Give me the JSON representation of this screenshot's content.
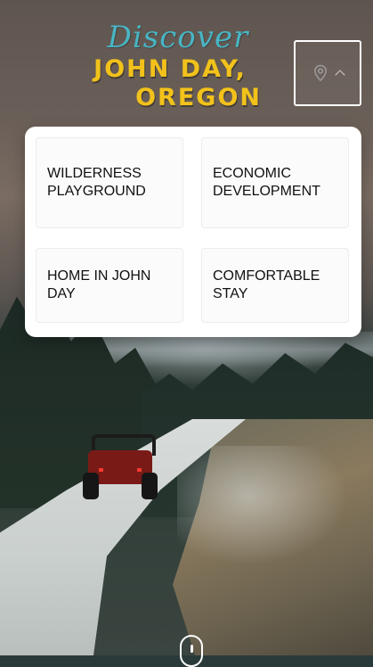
{
  "logo": {
    "line1": "Discover",
    "line2": "JOHN DAY,",
    "line3": "OREGON"
  },
  "location_button": {
    "icon": "map-pin-icon",
    "caret_icon": "chevron-up-icon"
  },
  "menu": {
    "items": [
      {
        "label": "WILDERNESS PLAYGROUND"
      },
      {
        "label": "ECONOMIC DEVELOPMENT"
      },
      {
        "label": "HOME IN JOHN DAY"
      },
      {
        "label": "COMFORTABLE STAY"
      }
    ]
  },
  "scroll_indicator": {
    "icon": "mouse-scroll-icon"
  },
  "colors": {
    "logo_teal": "#47b5c4",
    "logo_yellow": "#f2c21b",
    "pin": "#9a9a9a"
  }
}
